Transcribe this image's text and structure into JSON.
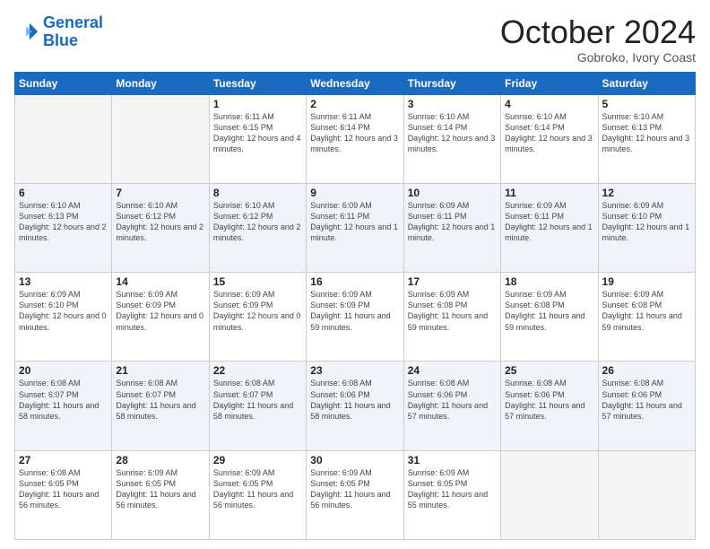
{
  "logo": {
    "line1": "General",
    "line2": "Blue"
  },
  "header": {
    "month": "October 2024",
    "location": "Gobroko, Ivory Coast"
  },
  "weekdays": [
    "Sunday",
    "Monday",
    "Tuesday",
    "Wednesday",
    "Thursday",
    "Friday",
    "Saturday"
  ],
  "weeks": [
    [
      {
        "day": "",
        "info": ""
      },
      {
        "day": "",
        "info": ""
      },
      {
        "day": "1",
        "info": "Sunrise: 6:11 AM\nSunset: 6:15 PM\nDaylight: 12 hours and 4 minutes."
      },
      {
        "day": "2",
        "info": "Sunrise: 6:11 AM\nSunset: 6:14 PM\nDaylight: 12 hours and 3 minutes."
      },
      {
        "day": "3",
        "info": "Sunrise: 6:10 AM\nSunset: 6:14 PM\nDaylight: 12 hours and 3 minutes."
      },
      {
        "day": "4",
        "info": "Sunrise: 6:10 AM\nSunset: 6:14 PM\nDaylight: 12 hours and 3 minutes."
      },
      {
        "day": "5",
        "info": "Sunrise: 6:10 AM\nSunset: 6:13 PM\nDaylight: 12 hours and 3 minutes."
      }
    ],
    [
      {
        "day": "6",
        "info": "Sunrise: 6:10 AM\nSunset: 6:13 PM\nDaylight: 12 hours and 2 minutes."
      },
      {
        "day": "7",
        "info": "Sunrise: 6:10 AM\nSunset: 6:12 PM\nDaylight: 12 hours and 2 minutes."
      },
      {
        "day": "8",
        "info": "Sunrise: 6:10 AM\nSunset: 6:12 PM\nDaylight: 12 hours and 2 minutes."
      },
      {
        "day": "9",
        "info": "Sunrise: 6:09 AM\nSunset: 6:11 PM\nDaylight: 12 hours and 1 minute."
      },
      {
        "day": "10",
        "info": "Sunrise: 6:09 AM\nSunset: 6:11 PM\nDaylight: 12 hours and 1 minute."
      },
      {
        "day": "11",
        "info": "Sunrise: 6:09 AM\nSunset: 6:11 PM\nDaylight: 12 hours and 1 minute."
      },
      {
        "day": "12",
        "info": "Sunrise: 6:09 AM\nSunset: 6:10 PM\nDaylight: 12 hours and 1 minute."
      }
    ],
    [
      {
        "day": "13",
        "info": "Sunrise: 6:09 AM\nSunset: 6:10 PM\nDaylight: 12 hours and 0 minutes."
      },
      {
        "day": "14",
        "info": "Sunrise: 6:09 AM\nSunset: 6:09 PM\nDaylight: 12 hours and 0 minutes."
      },
      {
        "day": "15",
        "info": "Sunrise: 6:09 AM\nSunset: 6:09 PM\nDaylight: 12 hours and 0 minutes."
      },
      {
        "day": "16",
        "info": "Sunrise: 6:09 AM\nSunset: 6:09 PM\nDaylight: 11 hours and 59 minutes."
      },
      {
        "day": "17",
        "info": "Sunrise: 6:09 AM\nSunset: 6:08 PM\nDaylight: 11 hours and 59 minutes."
      },
      {
        "day": "18",
        "info": "Sunrise: 6:09 AM\nSunset: 6:08 PM\nDaylight: 11 hours and 59 minutes."
      },
      {
        "day": "19",
        "info": "Sunrise: 6:09 AM\nSunset: 6:08 PM\nDaylight: 11 hours and 59 minutes."
      }
    ],
    [
      {
        "day": "20",
        "info": "Sunrise: 6:08 AM\nSunset: 6:07 PM\nDaylight: 11 hours and 58 minutes."
      },
      {
        "day": "21",
        "info": "Sunrise: 6:08 AM\nSunset: 6:07 PM\nDaylight: 11 hours and 58 minutes."
      },
      {
        "day": "22",
        "info": "Sunrise: 6:08 AM\nSunset: 6:07 PM\nDaylight: 11 hours and 58 minutes."
      },
      {
        "day": "23",
        "info": "Sunrise: 6:08 AM\nSunset: 6:06 PM\nDaylight: 11 hours and 58 minutes."
      },
      {
        "day": "24",
        "info": "Sunrise: 6:08 AM\nSunset: 6:06 PM\nDaylight: 11 hours and 57 minutes."
      },
      {
        "day": "25",
        "info": "Sunrise: 6:08 AM\nSunset: 6:06 PM\nDaylight: 11 hours and 57 minutes."
      },
      {
        "day": "26",
        "info": "Sunrise: 6:08 AM\nSunset: 6:06 PM\nDaylight: 11 hours and 57 minutes."
      }
    ],
    [
      {
        "day": "27",
        "info": "Sunrise: 6:08 AM\nSunset: 6:05 PM\nDaylight: 11 hours and 56 minutes."
      },
      {
        "day": "28",
        "info": "Sunrise: 6:09 AM\nSunset: 6:05 PM\nDaylight: 11 hours and 56 minutes."
      },
      {
        "day": "29",
        "info": "Sunrise: 6:09 AM\nSunset: 6:05 PM\nDaylight: 11 hours and 56 minutes."
      },
      {
        "day": "30",
        "info": "Sunrise: 6:09 AM\nSunset: 6:05 PM\nDaylight: 11 hours and 56 minutes."
      },
      {
        "day": "31",
        "info": "Sunrise: 6:09 AM\nSunset: 6:05 PM\nDaylight: 11 hours and 55 minutes."
      },
      {
        "day": "",
        "info": ""
      },
      {
        "day": "",
        "info": ""
      }
    ]
  ]
}
